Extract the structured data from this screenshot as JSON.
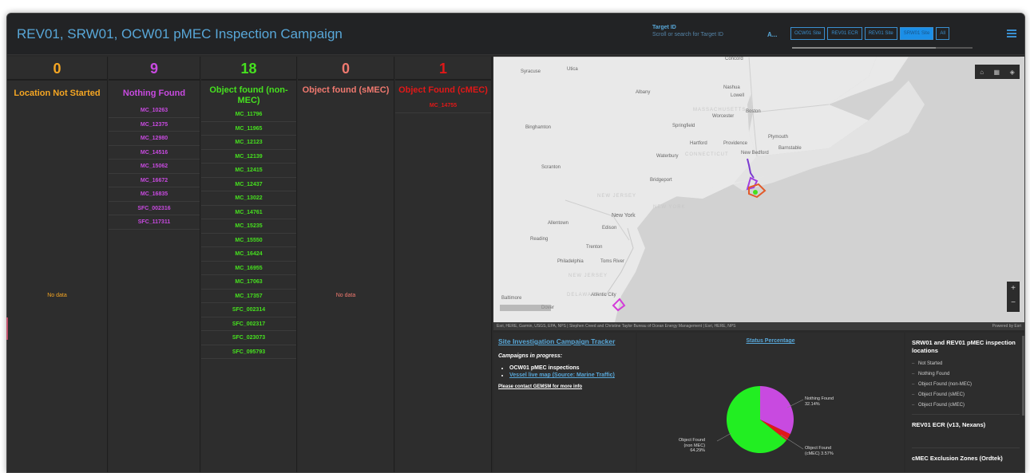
{
  "header": {
    "title": "REV01, SRW01, OCW01 pMEC Inspection Campaign",
    "target_id_label": "Target ID",
    "target_id_placeholder": "Scroll or search for Target ID",
    "target_prefix": "A...",
    "tabs": [
      "OCW01 Site",
      "REV01 ECR",
      "REV01 Site",
      "SRW01 Site",
      "All"
    ],
    "active_tab": "SRW01 Site"
  },
  "columns": [
    {
      "count": "0",
      "title": "Location Not Started",
      "color": "#f5a623",
      "items": [],
      "empty_text": "No data"
    },
    {
      "count": "9",
      "title": "Nothing Found",
      "color": "#c84ae0",
      "items": [
        "MC_10263",
        "MC_12375",
        "MC_12980",
        "MC_14516",
        "MC_15062",
        "MC_16672",
        "MC_16835",
        "SFC_002316",
        "SFC_117311"
      ]
    },
    {
      "count": "18",
      "title": "Object found (non-MEC)",
      "color": "#46e01f",
      "items": [
        "MC_11796",
        "MC_11965",
        "MC_12123",
        "MC_12139",
        "MC_12415",
        "MC_12437",
        "MC_13022",
        "MC_14761",
        "MC_15235",
        "MC_15550",
        "MC_16424",
        "MC_16955",
        "MC_17063",
        "MC_17357",
        "SFC_002314",
        "SFC_002317",
        "SFC_023073",
        "SFC_095793"
      ]
    },
    {
      "count": "0",
      "title": "Object found (sMEC)",
      "color": "#f0796f",
      "items": [],
      "empty_text": "No data"
    },
    {
      "count": "1",
      "title": "Object Found (cMEC)",
      "color": "#e01818",
      "items": [
        "MC_14755"
      ]
    }
  ],
  "map": {
    "labels": [
      "Syracuse",
      "Utica",
      "Albany",
      "Concord",
      "Nashua",
      "Lowell",
      "Boston",
      "Worcester",
      "Springfield",
      "Binghamton",
      "Hartford",
      "Providence",
      "Plymouth",
      "New Bedford",
      "Barnstable",
      "Waterbury",
      "Scranton",
      "Bridgeport",
      "New York",
      "Allentown",
      "Edison",
      "Reading",
      "Trenton",
      "Philadelphia",
      "Toms River",
      "Atlantic City",
      "Baltimore",
      "Dover"
    ],
    "region_labels": [
      "MASSACHUSETTS",
      "CONNECTICUT",
      "NEW JERSEY",
      "NEW YORK",
      "NEW JERSEY",
      "DELAWARE"
    ],
    "attribution": "Esri, HERE, Garmin, USGS, EPA, NPS | Stephen Creed and Christine Taylor Bureau of Ocean Energy Management | Esri, HERE, NPS",
    "powered_by": "Powered by Esri"
  },
  "tracker": {
    "title": "Site Investigation Campaign Tracker",
    "subtitle": "Campaigns in progress:",
    "bullet1": "OCW01 pMEC inspections",
    "bullet2": "Vessel live map (Source: Marine Traffic)",
    "contact": "Please contact GEMSM for more info"
  },
  "status": {
    "title": "Status Percentage",
    "label_nothing": "Nothing Found\n32.14%",
    "label_cmec": "Object Found\n(cMEC) 3.57%",
    "label_nonmec": "Object Found\n(non MEC)\n64.29%"
  },
  "chart_data": {
    "type": "pie",
    "title": "Status Percentage",
    "categories": [
      "Nothing Found",
      "Object Found (cMEC)",
      "Object Found (non MEC)"
    ],
    "values": [
      32.14,
      3.57,
      64.29
    ],
    "colors": [
      "#c84ae0",
      "#e01818",
      "#22ee22"
    ]
  },
  "legend": {
    "title": "SRW01 and REV01 pMEC inspection locations",
    "items": [
      "Not Started",
      "Nothing Found",
      "Object Found (non-MEC)",
      "Object Found (sMEC)",
      "Object Found (cMEC)"
    ],
    "section2": "REV01 ECR (v13, Nexans)",
    "section3": "cMEC Exclusion Zones (Ordtek)"
  }
}
